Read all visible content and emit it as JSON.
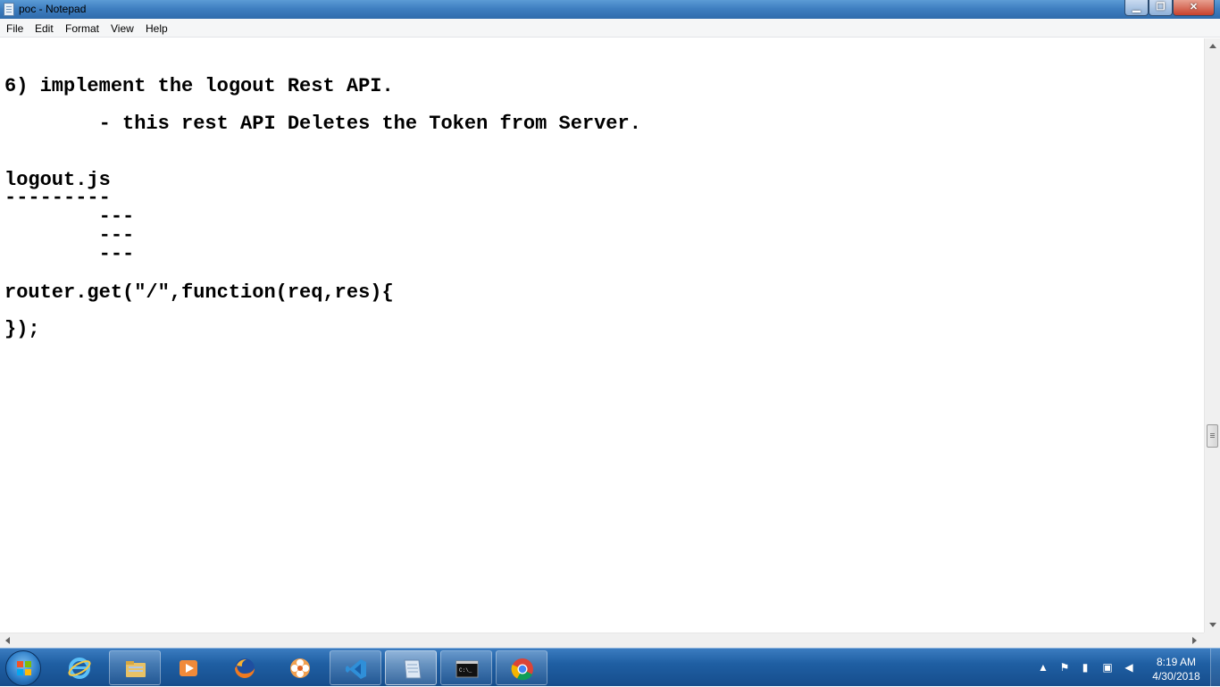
{
  "window": {
    "title": "poc - Notepad"
  },
  "menu": {
    "items": [
      "File",
      "Edit",
      "Format",
      "View",
      "Help"
    ]
  },
  "editor": {
    "lines": [
      "6) implement the logout Rest API.",
      "        - this rest API Deletes the Token from Server.",
      "logout.js",
      "---------",
      "        ---",
      "        ---",
      "        ---",
      "router.get(\"/\",function(req,res){",
      "});"
    ]
  },
  "taskbar": {
    "apps": [
      {
        "name": "internet-explorer",
        "icon": "ie-icon"
      },
      {
        "name": "file-explorer",
        "icon": "folder-icon"
      },
      {
        "name": "media-player",
        "icon": "play-icon"
      },
      {
        "name": "firefox",
        "icon": "firefox-icon"
      },
      {
        "name": "app-flower",
        "icon": "flower-icon"
      },
      {
        "name": "vscode",
        "icon": "vscode-icon"
      },
      {
        "name": "notepad",
        "icon": "notepad-icon",
        "active": true
      },
      {
        "name": "command-prompt",
        "icon": "cmd-icon"
      },
      {
        "name": "chrome",
        "icon": "chrome-icon"
      }
    ],
    "clock": {
      "time": "8:19 AM",
      "date": "4/30/2018"
    }
  },
  "colors": {
    "titlebar": "#3f7fc1",
    "taskbar": "#1f5fa3",
    "text": "#000000"
  }
}
